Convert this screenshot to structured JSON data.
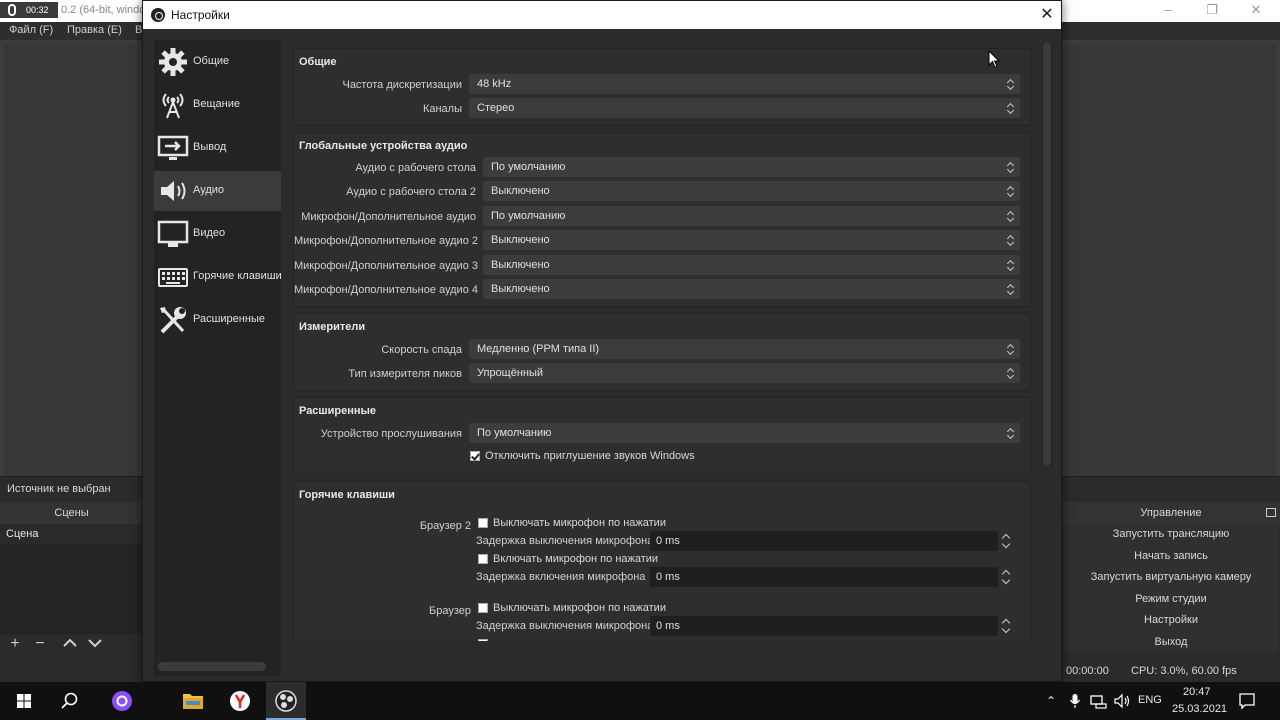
{
  "obs_window": {
    "recording_time": "00:32",
    "title_fragment": "0.2 (64-bit, windo",
    "menu": [
      "Файл (F)",
      "Правка (E)",
      "В"
    ],
    "no_source_label": "Источник не выбран",
    "scenes_header": "Сцены",
    "scenes": [
      "Сцена"
    ],
    "controls_header": "Управление",
    "controls": [
      "Запустить трансляцию",
      "Начать запись",
      "Запустить виртуальную камеру",
      "Режим студии",
      "Настройки",
      "Выход"
    ],
    "status_time": "00:00:00",
    "status_cpu": "CPU: 3.0%, 60.00 fps"
  },
  "settings": {
    "title": "Настройки",
    "sidebar": [
      {
        "label": "Общие",
        "icon": "gear-icon",
        "active": false
      },
      {
        "label": "Вещание",
        "icon": "broadcast-icon",
        "active": false
      },
      {
        "label": "Вывод",
        "icon": "output-icon",
        "active": false
      },
      {
        "label": "Аудио",
        "icon": "speaker-icon",
        "active": true
      },
      {
        "label": "Видео",
        "icon": "monitor-icon",
        "active": false
      },
      {
        "label": "Горячие клавиши",
        "icon": "keyboard-icon",
        "active": false
      },
      {
        "label": "Расширенные",
        "icon": "tools-icon",
        "active": false
      }
    ],
    "general": {
      "title": "Общие",
      "sample_rate_label": "Частота дискретизации",
      "sample_rate_value": "48 kHz",
      "channels_label": "Каналы",
      "channels_value": "Стерео"
    },
    "global_audio": {
      "title": "Глобальные устройства аудио",
      "rows": [
        {
          "label": "Аудио с рабочего стола",
          "value": "По умолчанию"
        },
        {
          "label": "Аудио с рабочего стола 2",
          "value": "Выключено"
        },
        {
          "label": "Микрофон/Дополнительное аудио",
          "value": "По умолчанию"
        },
        {
          "label": "Микрофон/Дополнительное аудио 2",
          "value": "Выключено"
        },
        {
          "label": "Микрофон/Дополнительное аудио 3",
          "value": "Выключено"
        },
        {
          "label": "Микрофон/Дополнительное аудио 4",
          "value": "Выключено"
        }
      ]
    },
    "meters": {
      "title": "Измерители",
      "decay_label": "Скорость спада",
      "decay_value": "Медленно (PPM типа II)",
      "peak_label": "Тип измерителя пиков",
      "peak_value": "Упрощённый"
    },
    "advanced": {
      "title": "Расширенные",
      "monitoring_label": "Устройство прослушивания",
      "monitoring_value": "По умолчанию",
      "ducking_label": "Отключить приглушение звуков Windows",
      "ducking_checked": true
    },
    "hotkeys": {
      "title": "Горячие клавиши",
      "browser2_label": "Браузер 2",
      "browser_label": "Браузер",
      "mute_ptt_label": "Выключать микрофон по нажатии",
      "mute_delay_label": "Задержка выключения микрофона",
      "ptt_label": "Включать микрофон по нажатии",
      "ptt_delay_label": "Задержка включения микрофона",
      "delay_value": "0 ms"
    }
  },
  "taskbar": {
    "language": "ENG",
    "time": "20:47",
    "date": "25.03.2021"
  }
}
